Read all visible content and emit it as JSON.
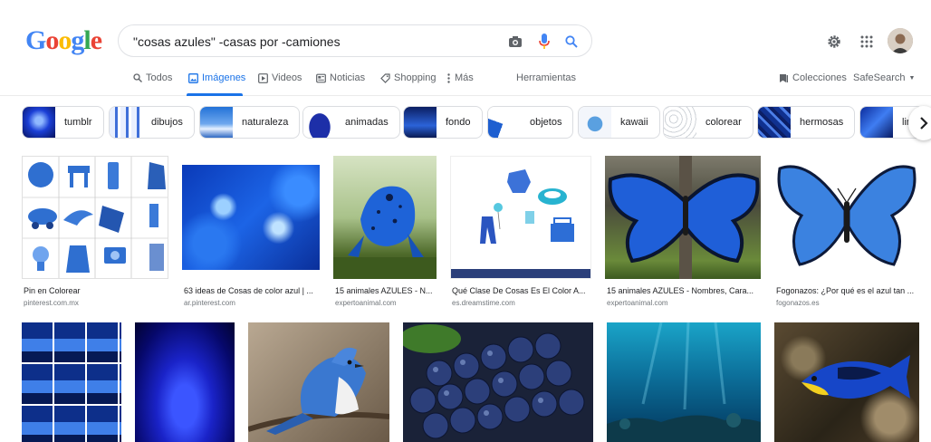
{
  "logo": {
    "letters": [
      "G",
      "o",
      "o",
      "g",
      "l",
      "e"
    ],
    "colors": [
      "#4285f4",
      "#ea4335",
      "#fbbc05",
      "#4285f4",
      "#34a853",
      "#ea4335"
    ]
  },
  "search": {
    "query": "\"cosas azules\" -casas por -camiones"
  },
  "icons": {
    "camera": "camera-icon",
    "mic": "microphone-icon",
    "search": "search-icon",
    "settings": "gear-icon",
    "apps": "apps-grid-icon"
  },
  "tabs": [
    {
      "label": "Todos",
      "icon": "search-icon"
    },
    {
      "label": "Imágenes",
      "icon": "image-icon"
    },
    {
      "label": "Videos",
      "icon": "play-icon"
    },
    {
      "label": "Noticias",
      "icon": "news-icon"
    },
    {
      "label": "Shopping",
      "icon": "tag-icon"
    },
    {
      "label": "Más",
      "icon": "more-vertical-icon"
    }
  ],
  "tools_label": "Herramientas",
  "collections_label": "Colecciones",
  "safesearch_label": "SafeSearch",
  "chips": [
    "tumblr",
    "dibujos",
    "naturaleza",
    "animadas",
    "fondo",
    "objetos",
    "kawaii",
    "colorear",
    "hermosas",
    "lin"
  ],
  "results_row1": [
    {
      "title": "Pin en Colorear",
      "source": "pinterest.com.mx"
    },
    {
      "title": "63 ideas de Cosas de color azul | ...",
      "source": "ar.pinterest.com"
    },
    {
      "title": "15 animales AZULES - N...",
      "source": "expertoanimal.com"
    },
    {
      "title": "Qué Clase De Cosas Es El Color A...",
      "source": "es.dreamstime.com"
    },
    {
      "title": "15 animales AZULES - Nombres, Cara...",
      "source": "expertoanimal.com"
    },
    {
      "title": "Fogonazos: ¿Por qué es el azul tan ...",
      "source": "fogonazos.es"
    }
  ],
  "colors": {
    "accent": "#1a73e8",
    "text": "#202124",
    "muted": "#5f6368",
    "source": "#70757a",
    "border": "#dadce0"
  }
}
